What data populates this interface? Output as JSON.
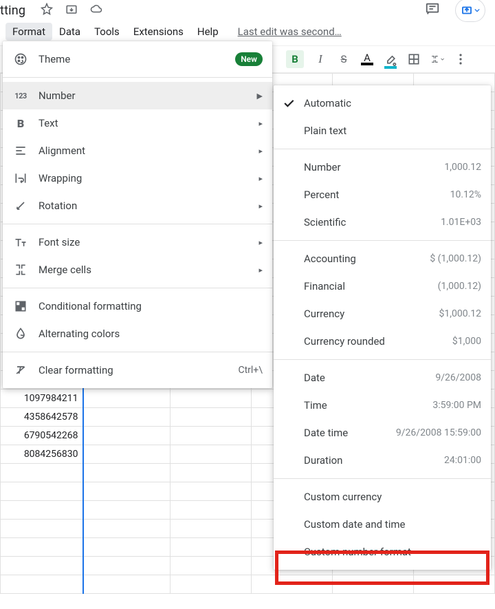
{
  "doc_title": "matting",
  "menubar": {
    "items": [
      {
        "label": "Format",
        "active": true
      },
      {
        "label": "Data"
      },
      {
        "label": "Tools"
      },
      {
        "label": "Extensions"
      },
      {
        "label": "Help"
      }
    ],
    "last_edit": "Last edit was second…"
  },
  "format_menu": {
    "theme": {
      "label": "Theme",
      "badge": "New"
    },
    "number": {
      "label": "Number"
    },
    "text": {
      "label": "Text"
    },
    "alignment": {
      "label": "Alignment"
    },
    "wrapping": {
      "label": "Wrapping"
    },
    "rotation": {
      "label": "Rotation"
    },
    "font_size": {
      "label": "Font size"
    },
    "merge": {
      "label": "Merge cells"
    },
    "conditional": {
      "label": "Conditional formatting"
    },
    "alternating": {
      "label": "Alternating colors"
    },
    "clear": {
      "label": "Clear formatting",
      "shortcut": "Ctrl+\\"
    }
  },
  "number_submenu": {
    "group_basic": [
      {
        "label": "Automatic",
        "checked": true
      },
      {
        "label": "Plain text"
      }
    ],
    "group_numeric": [
      {
        "label": "Number",
        "example": "1,000.12"
      },
      {
        "label": "Percent",
        "example": "10.12%"
      },
      {
        "label": "Scientific",
        "example": "1.01E+03"
      }
    ],
    "group_currency": [
      {
        "label": "Accounting",
        "example": "$ (1,000.12)"
      },
      {
        "label": "Financial",
        "example": "(1,000.12)"
      },
      {
        "label": "Currency",
        "example": "$1,000.12"
      },
      {
        "label": "Currency rounded",
        "example": "$1,000"
      }
    ],
    "group_datetime": [
      {
        "label": "Date",
        "example": "9/26/2008"
      },
      {
        "label": "Time",
        "example": "3:59:00 PM"
      },
      {
        "label": "Date time",
        "example": "9/26/2008 15:59:00"
      },
      {
        "label": "Duration",
        "example": "24:01:00"
      }
    ],
    "group_custom": [
      {
        "label": "Custom currency"
      },
      {
        "label": "Custom date and time"
      },
      {
        "label": "Custom number format"
      }
    ]
  },
  "sheet_cells": [
    "1097984211",
    "4358642578",
    "6790542268",
    "8084256830"
  ],
  "toolbar": {
    "bold": "B",
    "italic": "I",
    "strike": "S",
    "text_color_letter": "A"
  }
}
